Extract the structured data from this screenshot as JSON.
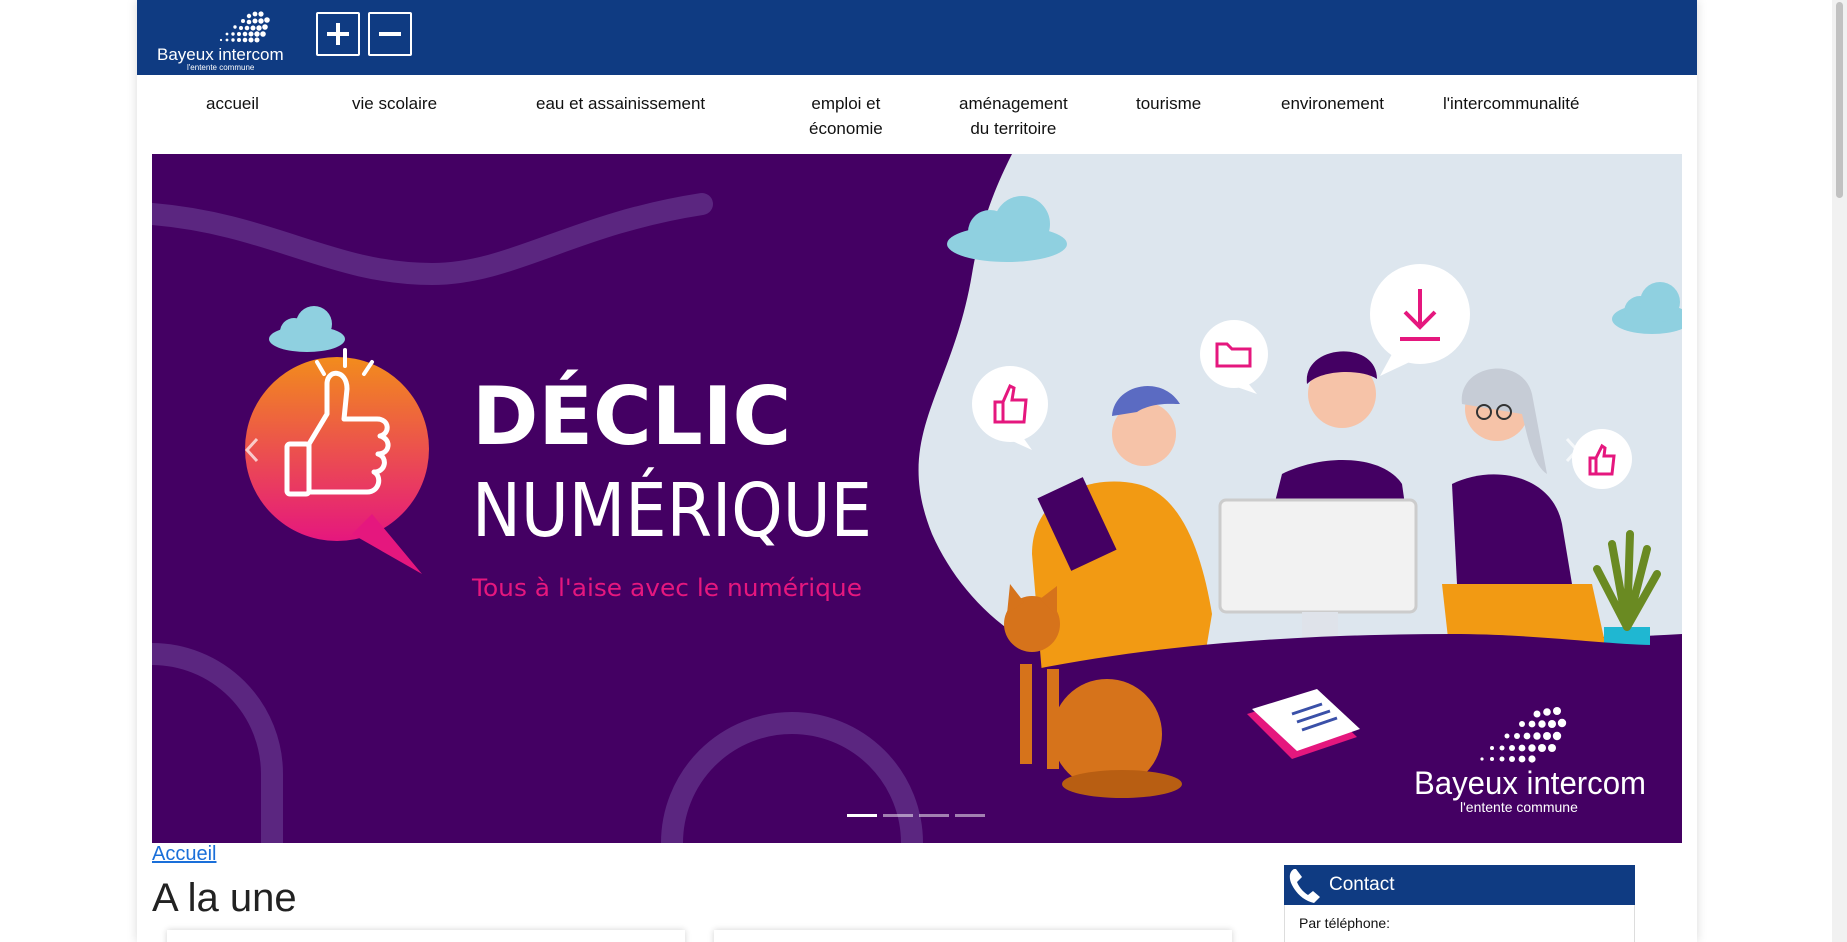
{
  "header": {
    "logo_text": "Bayeux intercom",
    "logo_tagline": "l'entente commune",
    "zoom_in_label": "+",
    "zoom_out_label": "−"
  },
  "nav": {
    "items": [
      {
        "label": "accueil"
      },
      {
        "label": "vie scolaire"
      },
      {
        "label": "eau et assainissement"
      },
      {
        "label": "emploi et économie",
        "line1": "emploi et",
        "line2": "économie"
      },
      {
        "label": "aménagement du territoire",
        "line1": "aménagement",
        "line2": "du territoire"
      },
      {
        "label": "tourisme"
      },
      {
        "label": "environement"
      },
      {
        "label": "l'intercommunalité"
      }
    ]
  },
  "hero": {
    "title_line1": "DÉCLIC",
    "title_line2": "NUMÉRIQUE",
    "subtitle": "Tous à l'aise avec le numérique",
    "logo_text": "Bayeux intercom",
    "logo_tagline": "l'entente commune",
    "active_slide": 1,
    "slide_count": 4
  },
  "breadcrumb": {
    "label": "Accueil"
  },
  "main": {
    "heading": "A la une"
  },
  "contact": {
    "title": "Contact",
    "phone_label": "Par téléphone:"
  },
  "colors": {
    "header_bg": "#0f3b82",
    "hero_purple": "#440063",
    "hero_pink": "#e5177e",
    "link": "#1a6fd9"
  }
}
